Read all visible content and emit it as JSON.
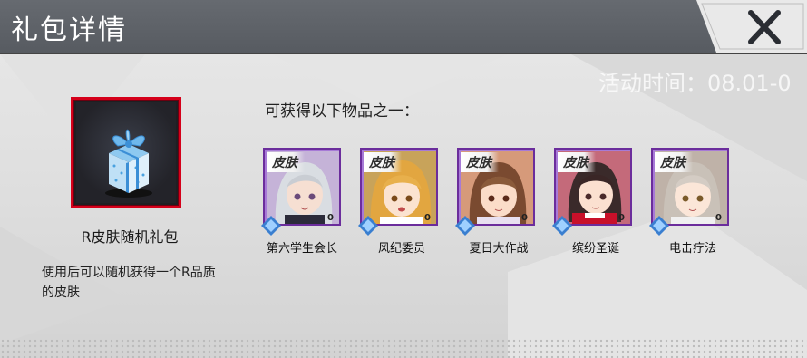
{
  "header": {
    "title": "礼包详情",
    "close_icon": "close-x-icon"
  },
  "event": {
    "time_text": "活动时间：08.01-0"
  },
  "gift": {
    "name": "R皮肤随机礼包",
    "description": "使用后可以随机获得一个R品质的皮肤",
    "icon": "gift-box-icon",
    "frame_color": "#d5001a"
  },
  "items": {
    "title": "可获得以下物品之一：",
    "tag": "皮肤",
    "list": [
      {
        "name": "第六学生会长",
        "count": "0"
      },
      {
        "name": "风纪委员",
        "count": "0"
      },
      {
        "name": "夏日大作战",
        "count": "0"
      },
      {
        "name": "缤纷圣诞",
        "count": "0"
      },
      {
        "name": "电击疗法",
        "count": "0"
      }
    ]
  },
  "colors": {
    "header_bg": "#5e6268",
    "card_border": "#6b2d9c",
    "card_bg": "#a77ad6"
  }
}
